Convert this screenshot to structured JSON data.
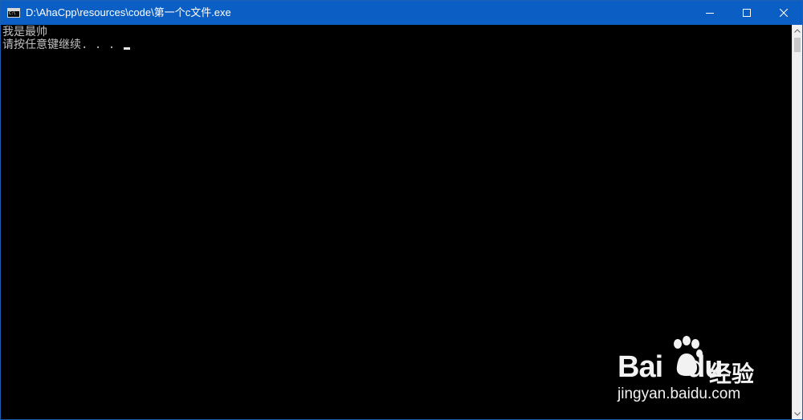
{
  "window": {
    "title": "D:\\AhaCpp\\resources\\code\\第一个c文件.exe",
    "icon": "console-icon",
    "icon_text": "C:\\",
    "controls": [
      "minimize-icon",
      "maximize-icon",
      "close-icon"
    ]
  },
  "console": {
    "lines": [
      "我是最帅",
      "请按任意键继续. . . "
    ],
    "text_color": "#c0c0c0",
    "background": "#000000"
  },
  "watermark": {
    "brand": "Bai",
    "brand_suffix": "du",
    "label": "经验",
    "url": "jingyan.baidu.com"
  },
  "colors": {
    "titlebar": "#0b5fc4",
    "scrollbar": "#f0f0f0"
  }
}
